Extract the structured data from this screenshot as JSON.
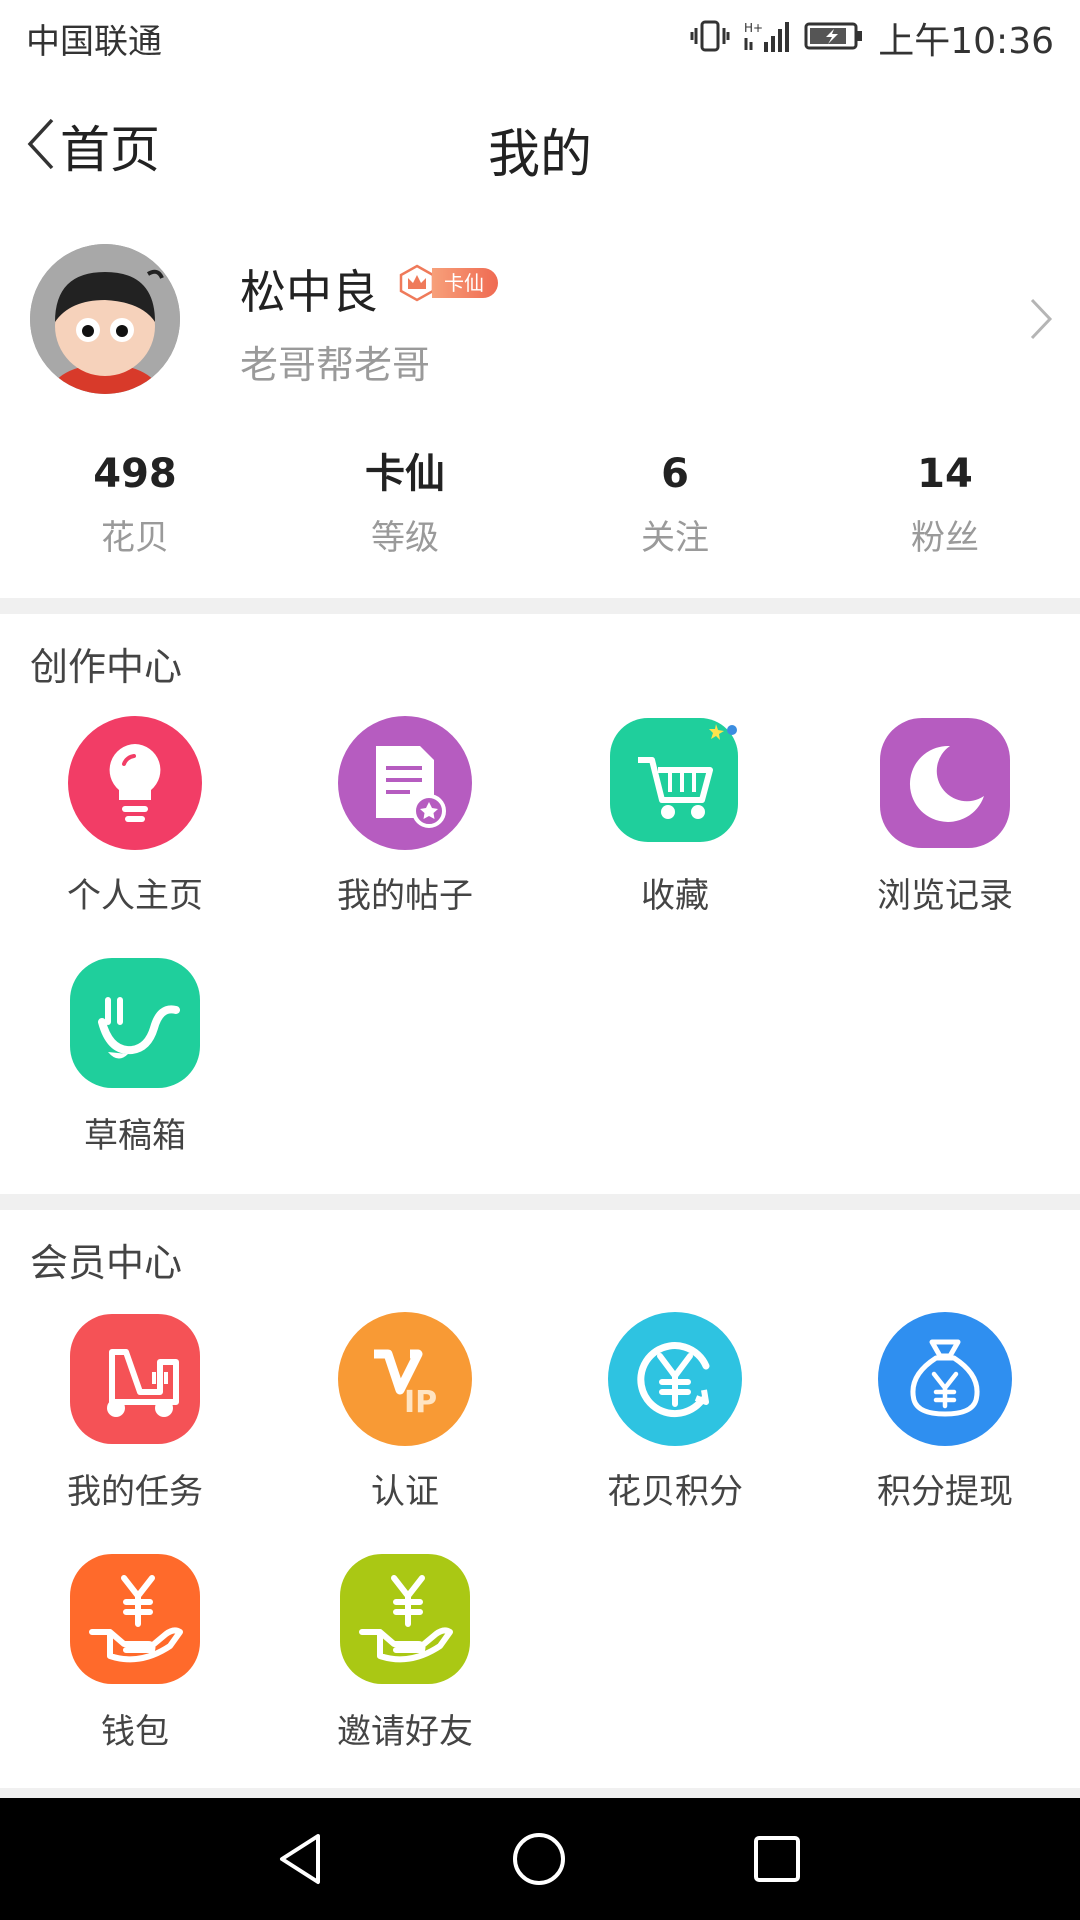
{
  "status_bar": {
    "carrier": "中国联通",
    "time": "上午10:36"
  },
  "nav": {
    "back_label": "首页",
    "title": "我的"
  },
  "profile": {
    "name": "松中良",
    "badge": "卡仙",
    "subtitle": "老哥帮老哥"
  },
  "stats": [
    {
      "value": "498",
      "label": "花贝"
    },
    {
      "value": "卡仙",
      "label": "等级"
    },
    {
      "value": "6",
      "label": "关注"
    },
    {
      "value": "14",
      "label": "粉丝"
    }
  ],
  "creation_center": {
    "title": "创作中心",
    "items": [
      {
        "label": "个人主页",
        "icon": "lightbulb-icon",
        "color": "#f23d66"
      },
      {
        "label": "我的帖子",
        "icon": "post-document-icon",
        "color": "#b65cc0"
      },
      {
        "label": "收藏",
        "icon": "shopping-cart-icon",
        "color": "#1fcf9c"
      },
      {
        "label": "浏览记录",
        "icon": "moon-icon",
        "color": "#b65cc0"
      },
      {
        "label": "草稿箱",
        "icon": "draft-box-icon",
        "color": "#1fcf9c"
      }
    ]
  },
  "member_center": {
    "title": "会员中心",
    "items": [
      {
        "label": "我的任务",
        "icon": "scooter-icon",
        "color": "#f55256"
      },
      {
        "label": "认证",
        "icon": "vip-icon",
        "color": "#f89a35"
      },
      {
        "label": "花贝积分",
        "icon": "yen-exchange-icon",
        "color": "#2ec3e1"
      },
      {
        "label": "积分提现",
        "icon": "money-bag-icon",
        "color": "#2f8ff0"
      },
      {
        "label": "钱包",
        "icon": "yen-hand-icon",
        "color": "#ff6a2b"
      },
      {
        "label": "邀请好友",
        "icon": "yen-hand-icon",
        "color": "#aac814"
      }
    ]
  }
}
